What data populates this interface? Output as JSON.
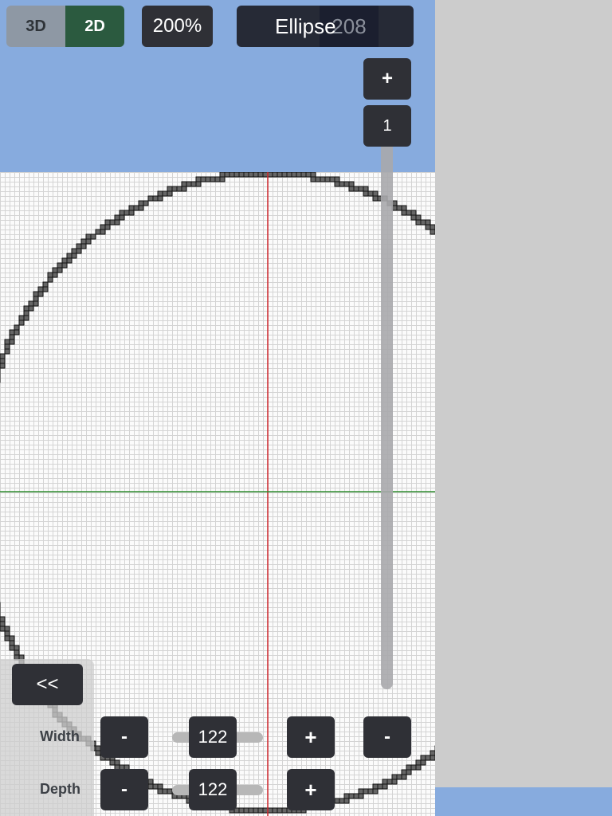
{
  "toolbar": {
    "view_3d": "3D",
    "view_2d": "2D",
    "zoom": "200%",
    "shape": "Ellipse",
    "shape_count": "208"
  },
  "layer": {
    "plus": "+",
    "value": "1"
  },
  "panel": {
    "collapse": "<<",
    "width_label": "Width",
    "depth_label": "Depth",
    "width_value": "122",
    "depth_value": "122",
    "minus": "-",
    "plus": "+",
    "extra_minus": "-"
  },
  "colors": {
    "sky": "#87abde",
    "grid_bg": "#fbfbfb",
    "block": "#666666",
    "axis_vertical": "#d0262c",
    "axis_horizontal": "#2d8b2d",
    "button": "#2f3036",
    "toggle_active": "#2b5a3f"
  }
}
